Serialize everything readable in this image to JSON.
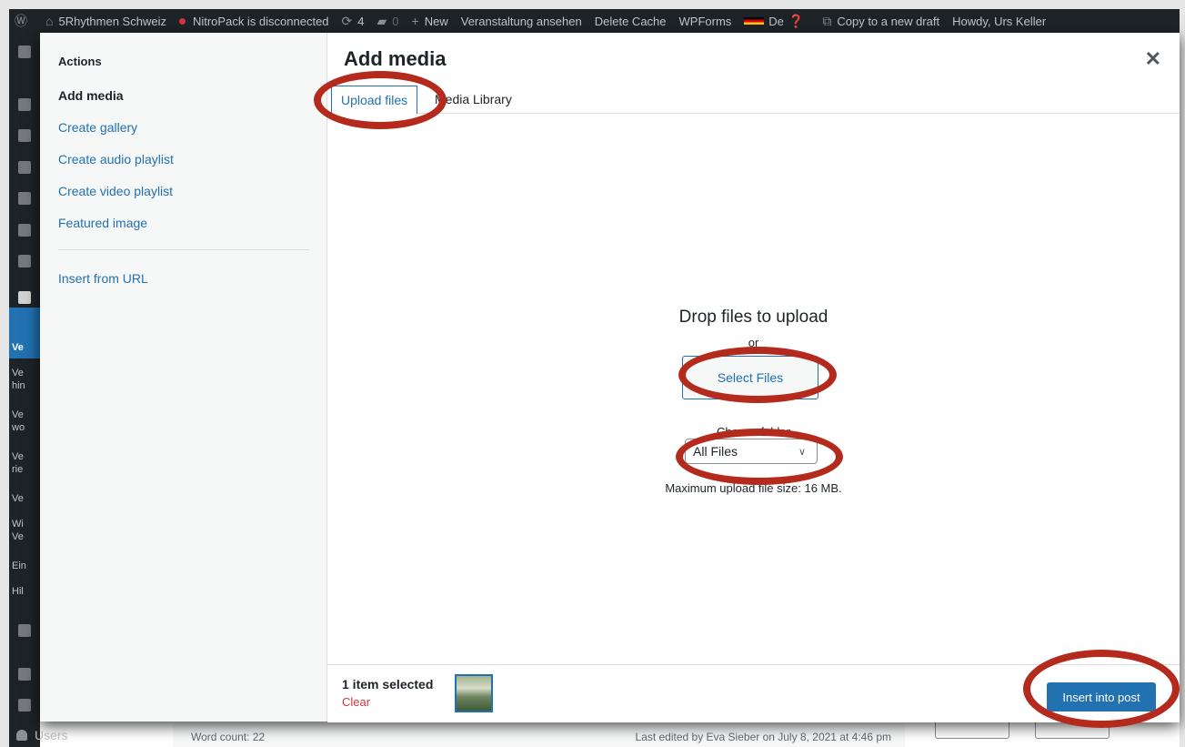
{
  "admin_bar": {
    "site_name": "5Rhythmen Schweiz",
    "nitropack": "NitroPack is disconnected",
    "updates_count": "4",
    "comments_count": "0",
    "new_label": "New",
    "view_event": "Veranstaltung ansehen",
    "delete_cache": "Delete Cache",
    "wpforms": "WPForms",
    "language": "De",
    "copy_draft": "Copy to a new draft",
    "howdy": "Howdy, Urs Keller"
  },
  "admin_menu": {
    "partial_labels": [
      "Ve",
      "Ve",
      "hin",
      "Ve",
      "wo",
      "Ve",
      "rie",
      "Ve",
      "Wi",
      "Ve",
      "Ein",
      "Hil"
    ],
    "users": "Users"
  },
  "editor": {
    "word_count": "Word count: 22",
    "last_edited": "Last edited by Eva Sieber on July 8, 2021 at 4:46 pm"
  },
  "modal": {
    "title": "Add media",
    "menu": {
      "heading": "Actions",
      "items": [
        "Add media",
        "Create gallery",
        "Create audio playlist",
        "Create video playlist",
        "Featured image",
        "Insert from URL"
      ]
    },
    "tabs": [
      "Upload files",
      "Media Library"
    ],
    "upload": {
      "drop_title": "Drop files to upload",
      "or": "or",
      "select_button": "Select Files",
      "filter_label": "Choose folder",
      "filter_value": "All Files",
      "max_size": "Maximum upload file size: 16 MB."
    },
    "toolbar": {
      "selection": "1 item selected",
      "clear": "Clear",
      "insert_button": "Insert into post"
    }
  },
  "colors": {
    "accent": "#2271b1",
    "admin_bar": "#1d2327",
    "annotation": "#b42a1c",
    "danger": "#d63638"
  }
}
